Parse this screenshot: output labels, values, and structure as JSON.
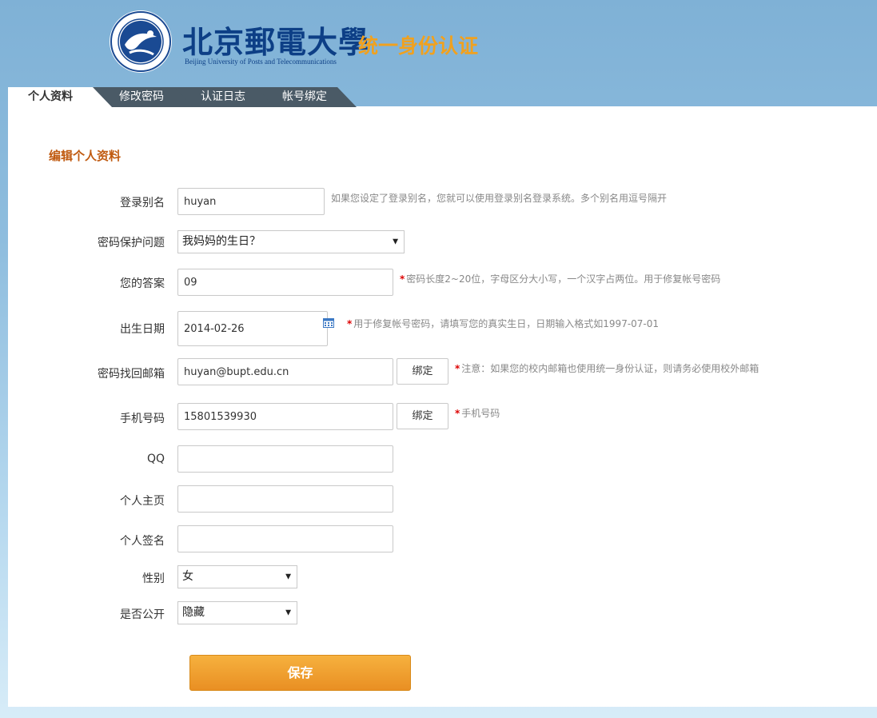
{
  "header": {
    "school_cn": "北京郵電大學",
    "school_en": "Beijing University of Posts and Telecommunications",
    "system_title": "统一身份认证"
  },
  "tabs": [
    {
      "label": "个人资料",
      "active": true
    },
    {
      "label": "修改密码",
      "active": false
    },
    {
      "label": "认证日志",
      "active": false
    },
    {
      "label": "帐号绑定",
      "active": false
    }
  ],
  "section_title": "编辑个人资料",
  "form": {
    "alias": {
      "label": "登录别名",
      "value": "huyan",
      "hint": "如果您设定了登录别名，您就可以使用登录别名登录系统。多个别名用逗号隔开"
    },
    "question": {
      "label": "密码保护问题",
      "value": "我妈妈的生日？"
    },
    "answer": {
      "label": "您的答案",
      "value": "09",
      "hint": "密码长度2~20位，字母区分大小写，一个汉字占两位。用于修复帐号密码"
    },
    "birthday": {
      "label": "出生日期",
      "value": "2014-02-26",
      "hint": "用于修复帐号密码，请填写您的真实生日，日期输入格式如1997-07-01"
    },
    "email": {
      "label": "密码找回邮箱",
      "value": "huyan@bupt.edu.cn",
      "button": "绑定",
      "hint": "注意：如果您的校内邮箱也使用统一身份认证，则请务必使用校外邮箱"
    },
    "phone": {
      "label": "手机号码",
      "value": "15801539930",
      "button": "绑定",
      "hint": "手机号码"
    },
    "qq": {
      "label": "QQ",
      "value": ""
    },
    "homepage": {
      "label": "个人主页",
      "value": ""
    },
    "signature": {
      "label": "个人签名",
      "value": ""
    },
    "gender": {
      "label": "性别",
      "value": "女"
    },
    "public": {
      "label": "是否公开",
      "value": "隐藏"
    }
  },
  "save_label": "保存",
  "colors": {
    "accent": "#f0a11f",
    "tab_bg": "#4a5a66",
    "title": "#c05a10",
    "required": "#dd0000"
  }
}
